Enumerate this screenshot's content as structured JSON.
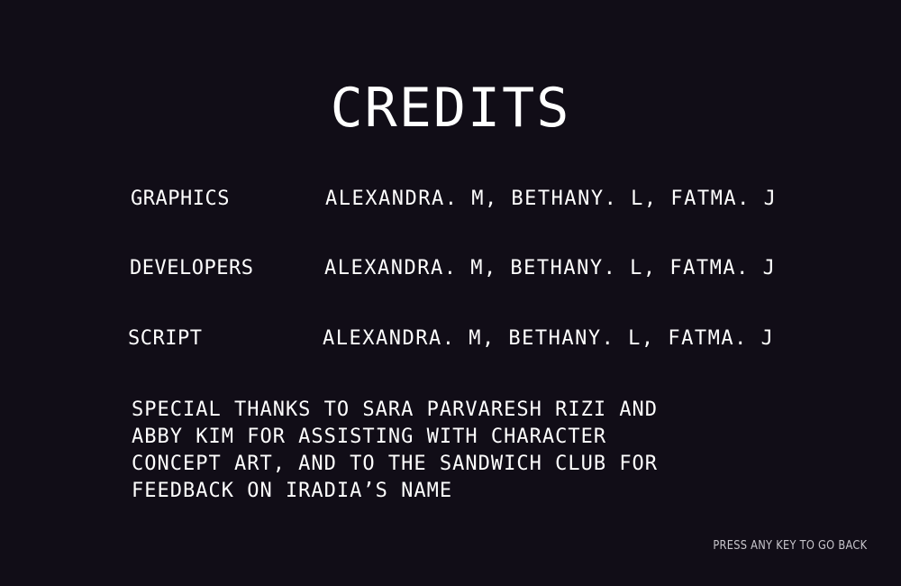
{
  "screen": {
    "title": "CREDITS",
    "credits": [
      {
        "role": "GRAPHICS",
        "names": "ALEXANDRA. M, BETHANY. L, FATMA. J"
      },
      {
        "role": "DEVELOPERS",
        "names": "ALEXANDRA. M, BETHANY. L, FATMA. J"
      },
      {
        "role": "SCRIPT",
        "names": "ALEXANDRA. M, BETHANY. L, FATMA. J"
      }
    ],
    "special_thanks": [
      "SPECIAL THANKS TO SARA PARVARESH RIZI AND",
      "ABBY KIM FOR ASSISTING WITH CHARACTER",
      "CONCEPT ART, AND TO THE SANDWICH CLUB FOR",
      "FEEDBACK ON IRADIA’S NAME"
    ],
    "back_hint": "PRESS ANY KEY TO GO BACK"
  },
  "colors": {
    "background": "#110d17",
    "text": "#ffffff",
    "hint": "#c8c6cc"
  }
}
